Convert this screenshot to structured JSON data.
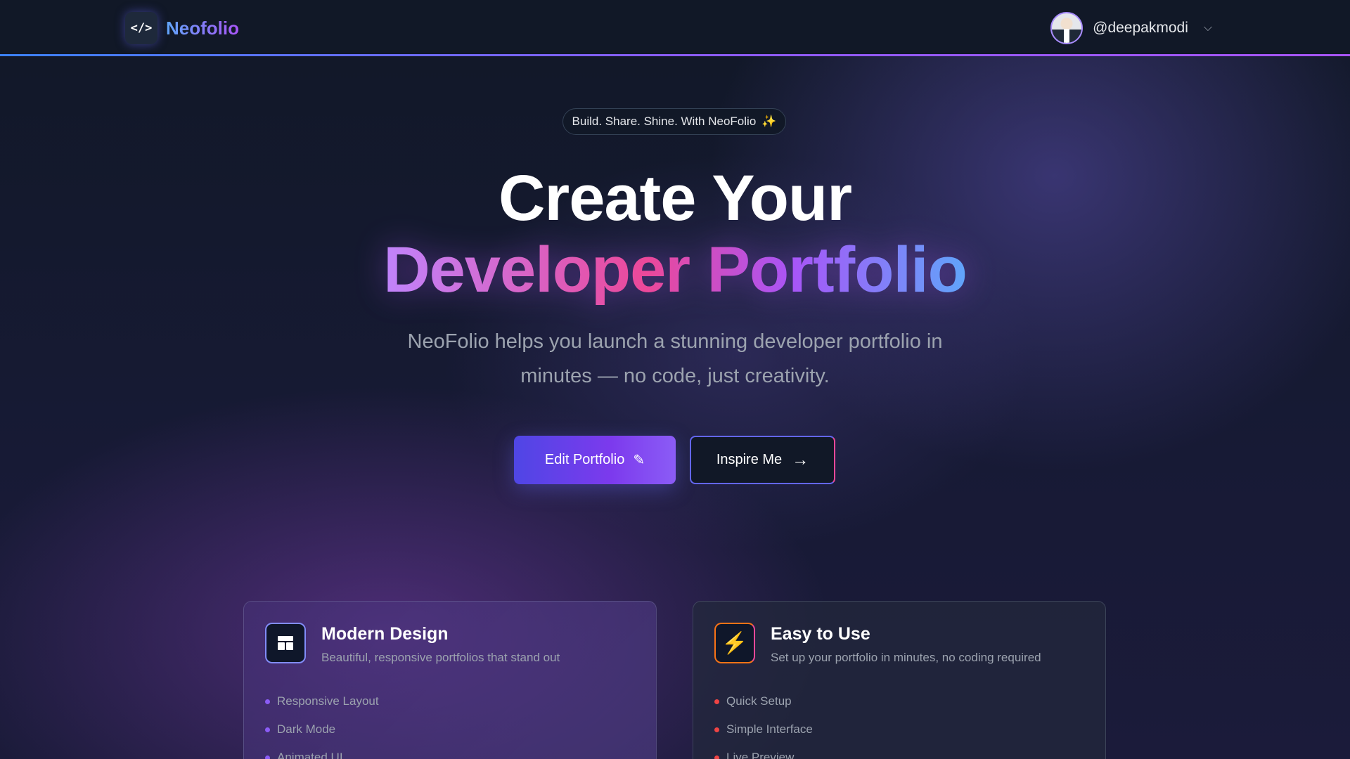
{
  "navbar": {
    "brand_logo": "</>",
    "brand_name": "Neofolio",
    "username": "@deepakmodi",
    "chevron": "⌵"
  },
  "hero": {
    "tagline": "Build. Share. Shine. With NeoFolio",
    "tagline_icon": "✨",
    "headline_line1": "Create Your",
    "headline_line2": "Developer Portfolio",
    "subtext": "NeoFolio helps you launch a stunning developer portfolio in minutes — no code, just creativity.",
    "edit_button": "Edit Portfolio",
    "edit_icon": "✎",
    "inspire_button": "Inspire Me",
    "inspire_icon": "→"
  },
  "features": [
    {
      "title": "Modern Design",
      "description": "Beautiful, responsive portfolios that stand out",
      "icon": "layout-icon",
      "items": [
        "Responsive Layout",
        "Dark Mode",
        "Animated UI"
      ]
    },
    {
      "title": "Easy to Use",
      "description": "Set up your portfolio in minutes, no coding required",
      "icon": "lightning-icon",
      "icon_glyph": "⚡",
      "items": [
        "Quick Setup",
        "Simple Interface",
        "Live Preview"
      ]
    }
  ],
  "colors": {
    "background": "#0f172a",
    "accent_blue": "#3b82f6",
    "accent_purple": "#8b5cf6",
    "accent_pink": "#ec4899"
  }
}
